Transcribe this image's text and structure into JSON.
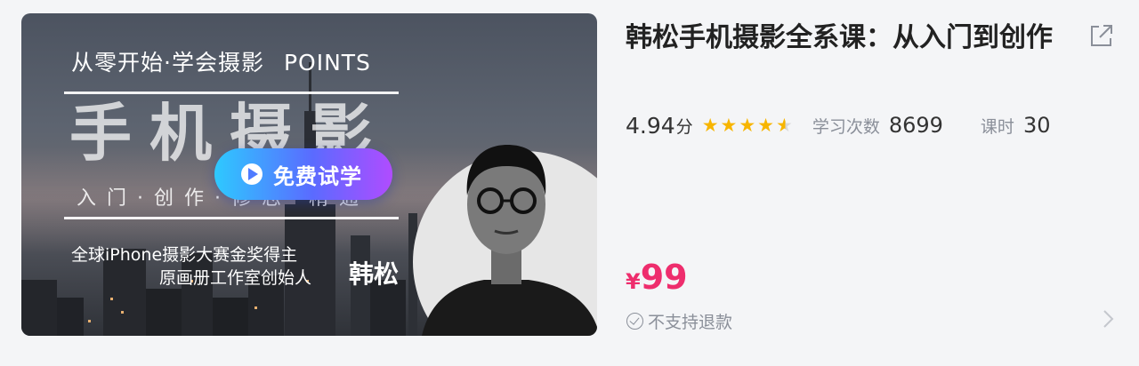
{
  "cover": {
    "top_line": "从零开始·学会摄影",
    "top_points": "POINTS",
    "big_title": "手机摄影",
    "subtitle": "入门·创作·修志·精通",
    "trial_button": "免费试学",
    "award": "全球iPhone摄影大赛金奖得主",
    "studio": "原画册工作室创始人",
    "teacher": "韩松"
  },
  "course": {
    "title": "韩松手机摄影全系课：从入门到创作",
    "score": "4.94",
    "score_unit": "分",
    "rating_stars": 4.94,
    "learn_count_label": "学习次数",
    "learn_count": "8699",
    "lessons_label": "课时",
    "lessons": "30",
    "currency": "¥",
    "price": "99",
    "refund_note": "不支持退款"
  },
  "colors": {
    "price": "#ee2d6d",
    "star": "#f7b500",
    "trial_gradient": [
      "#2ec9ff",
      "#5a6bff",
      "#b04cff"
    ],
    "background": "#f4f5f7"
  },
  "icons": {
    "share": "share-external-icon",
    "play": "play-icon",
    "refund": "check-circle-icon",
    "detail": "chevron-right-icon"
  }
}
